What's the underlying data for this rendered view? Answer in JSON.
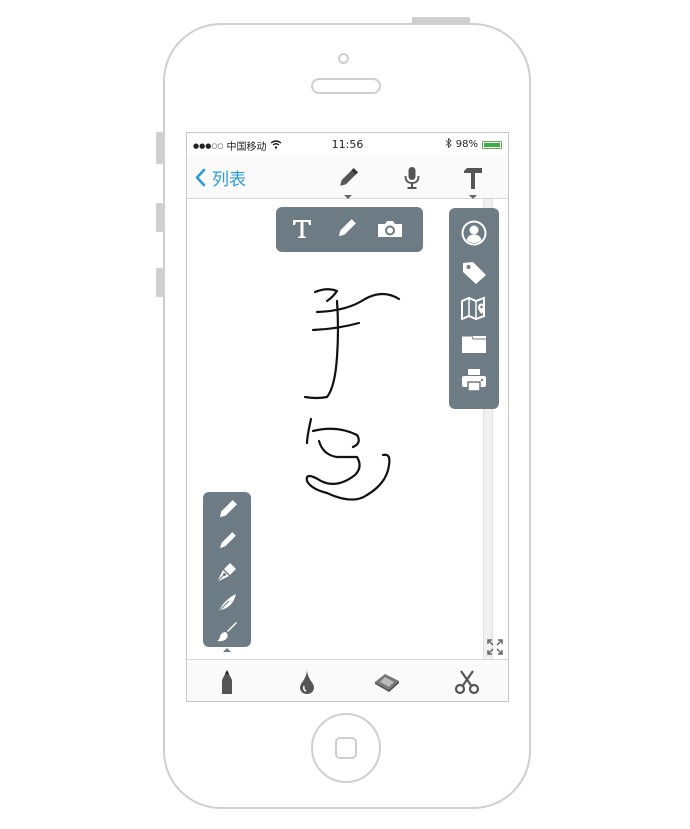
{
  "status_bar": {
    "signal": "●●●○○",
    "carrier": "中国移动",
    "time": "11:56",
    "battery_percent": "98%",
    "battery_level": 0.98,
    "battery_color": "#3cb043"
  },
  "nav_bar": {
    "back_label": "列表",
    "accent_color": "#2a9ad8",
    "icons": [
      "pencil-icon",
      "microphone-icon",
      "hammer-icon"
    ]
  },
  "insert_popup": {
    "items": [
      "text-icon",
      "pencil-icon",
      "camera-icon"
    ]
  },
  "tools_popup": {
    "items": [
      "contact-icon",
      "tag-icon",
      "map-location-icon",
      "folder-icon",
      "printer-icon"
    ]
  },
  "brush_popup": {
    "items": [
      "pencil-icon",
      "pencil-alt-icon",
      "fountain-pen-icon",
      "feather-icon",
      "brush-icon"
    ]
  },
  "canvas": {
    "handwriting": "手写",
    "popup_color": "#6d7b84"
  },
  "bottom_toolbar": {
    "items": [
      "pencil-tool-icon",
      "ink-drop-icon",
      "eraser-icon",
      "scissors-icon"
    ]
  }
}
